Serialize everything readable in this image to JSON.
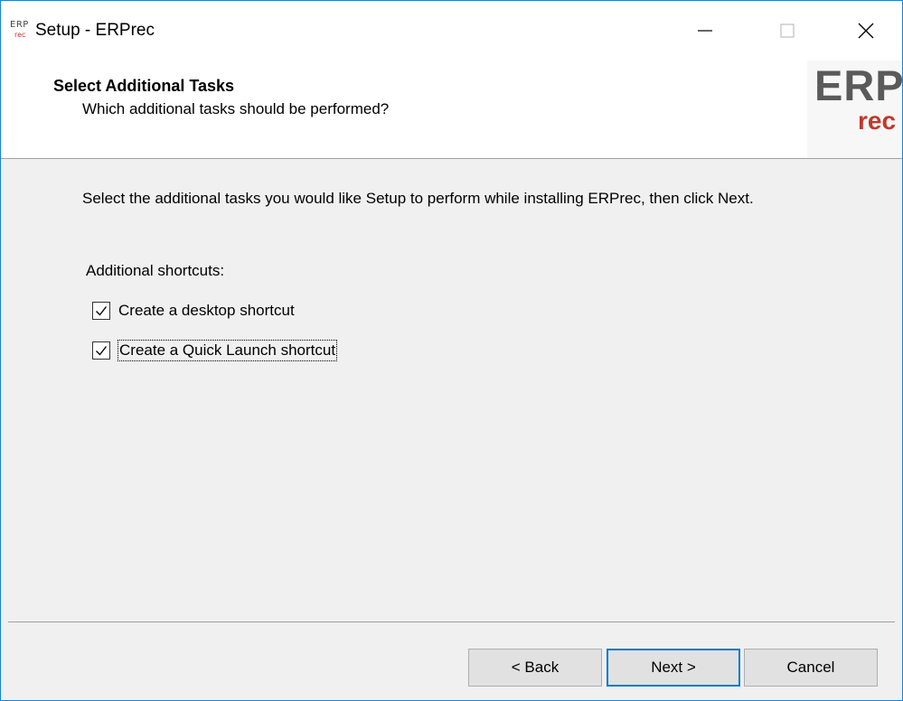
{
  "window": {
    "title": "Setup - ERPrec",
    "icon": "erprec-app-icon",
    "icon_text_top": "ERP",
    "icon_text_bottom": "rec"
  },
  "header": {
    "title": "Select Additional Tasks",
    "subtitle": "Which additional tasks should be performed?",
    "logo_main": "ERP",
    "logo_sub": "rec"
  },
  "main": {
    "description": "Select the additional tasks you would like Setup to perform while installing ERPrec, then click Next.",
    "group_label": "Additional shortcuts:",
    "tasks": [
      {
        "label": "Create a desktop shortcut",
        "checked": true
      },
      {
        "label": "Create a Quick Launch shortcut",
        "checked": true
      }
    ]
  },
  "buttons": {
    "back": "< Back",
    "next": "Next >",
    "cancel": "Cancel"
  },
  "colors": {
    "accent": "#0078d7",
    "window_border": "#1883d7",
    "logo_red": "#c0392b",
    "logo_grey": "#5a5a5a"
  }
}
